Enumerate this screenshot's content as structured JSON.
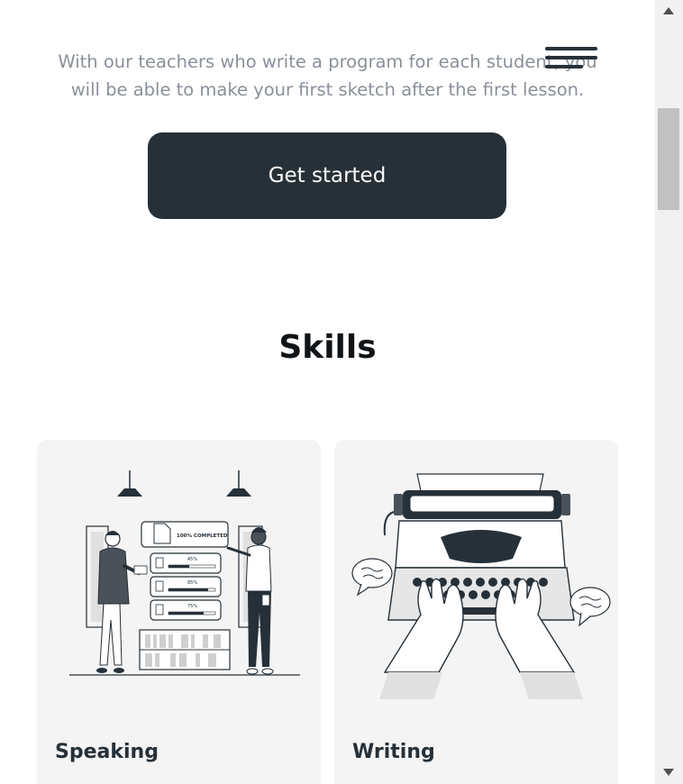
{
  "intro": {
    "line1": "With our teachers who write a program for each student, you",
    "line2": "will be able to make your first sketch after the first lesson."
  },
  "cta": {
    "label": "Get started"
  },
  "skills": {
    "title": "Skills",
    "cards": [
      {
        "title": "Speaking",
        "illustration": {
          "completed": "100% COMPLETED",
          "bars": [
            "45%",
            "85%",
            "75%"
          ]
        }
      },
      {
        "title": "Writing"
      }
    ]
  },
  "colors": {
    "primary": "#263038",
    "text_muted": "#8a9099",
    "card_bg": "#f4f4f4"
  },
  "icons": {
    "menu": "hamburger-icon",
    "scroll_up": "arrow-up-icon",
    "scroll_down": "arrow-down-icon"
  }
}
